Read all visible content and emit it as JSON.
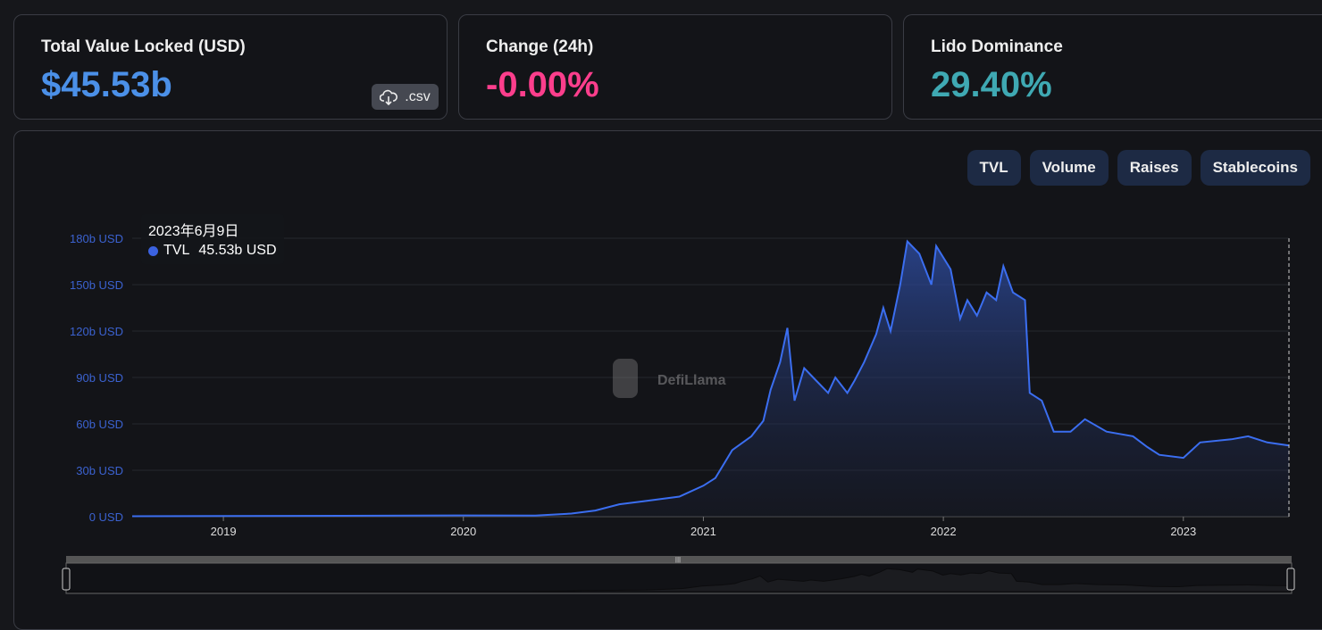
{
  "cards": [
    {
      "label": "Total Value Locked (USD)",
      "value": "$45.53b",
      "color": "#4b90e8",
      "csv_label": ".csv"
    },
    {
      "label": "Change (24h)",
      "value": "-0.00%",
      "color": "#fc3e8c"
    },
    {
      "label": "Lido Dominance",
      "value": "29.40%",
      "color": "#3fa9b3"
    }
  ],
  "tabs": [
    "TVL",
    "Volume",
    "Raises",
    "Stablecoins"
  ],
  "watermark": "DefiLlama",
  "tooltip": {
    "date": "2023年6月9日",
    "series": "TVL",
    "value": "45.53b USD"
  },
  "chart_data": {
    "type": "area",
    "series_name": "TVL",
    "unit": "b USD",
    "color": "#3b6ef0",
    "xlim": [
      2018.62,
      2023.44
    ],
    "ylim": [
      0,
      180
    ],
    "yticks": [
      "0 USD",
      "30b USD",
      "60b USD",
      "90b USD",
      "120b USD",
      "150b USD",
      "180b USD"
    ],
    "ytick_values": [
      0,
      30,
      60,
      90,
      120,
      150,
      180
    ],
    "xticks": [
      "2019",
      "2020",
      "2021",
      "2022",
      "2023"
    ],
    "xtick_values": [
      2019,
      2020,
      2021,
      2022,
      2023
    ],
    "points": [
      [
        2018.62,
        0.3
      ],
      [
        2019.0,
        0.4
      ],
      [
        2019.5,
        0.6
      ],
      [
        2020.0,
        0.8
      ],
      [
        2020.3,
        0.7
      ],
      [
        2020.45,
        2
      ],
      [
        2020.55,
        4
      ],
      [
        2020.65,
        8
      ],
      [
        2020.75,
        10
      ],
      [
        2020.9,
        13
      ],
      [
        2021.0,
        20
      ],
      [
        2021.05,
        25
      ],
      [
        2021.12,
        43
      ],
      [
        2021.2,
        52
      ],
      [
        2021.25,
        62
      ],
      [
        2021.28,
        82
      ],
      [
        2021.32,
        100
      ],
      [
        2021.35,
        122
      ],
      [
        2021.38,
        75
      ],
      [
        2021.42,
        96
      ],
      [
        2021.47,
        88
      ],
      [
        2021.52,
        80
      ],
      [
        2021.55,
        90
      ],
      [
        2021.6,
        80
      ],
      [
        2021.63,
        88
      ],
      [
        2021.67,
        100
      ],
      [
        2021.72,
        118
      ],
      [
        2021.75,
        135
      ],
      [
        2021.78,
        120
      ],
      [
        2021.82,
        150
      ],
      [
        2021.85,
        178
      ],
      [
        2021.9,
        170
      ],
      [
        2021.95,
        150
      ],
      [
        2021.97,
        175
      ],
      [
        2022.03,
        160
      ],
      [
        2022.07,
        128
      ],
      [
        2022.1,
        140
      ],
      [
        2022.14,
        130
      ],
      [
        2022.18,
        145
      ],
      [
        2022.22,
        140
      ],
      [
        2022.25,
        162
      ],
      [
        2022.29,
        145
      ],
      [
        2022.34,
        140
      ],
      [
        2022.36,
        80
      ],
      [
        2022.41,
        75
      ],
      [
        2022.46,
        55
      ],
      [
        2022.53,
        55
      ],
      [
        2022.59,
        63
      ],
      [
        2022.68,
        55
      ],
      [
        2022.79,
        52
      ],
      [
        2022.85,
        45
      ],
      [
        2022.9,
        40
      ],
      [
        2023.0,
        38
      ],
      [
        2023.07,
        48
      ],
      [
        2023.2,
        50
      ],
      [
        2023.27,
        52
      ],
      [
        2023.35,
        48
      ],
      [
        2023.44,
        46
      ]
    ]
  }
}
